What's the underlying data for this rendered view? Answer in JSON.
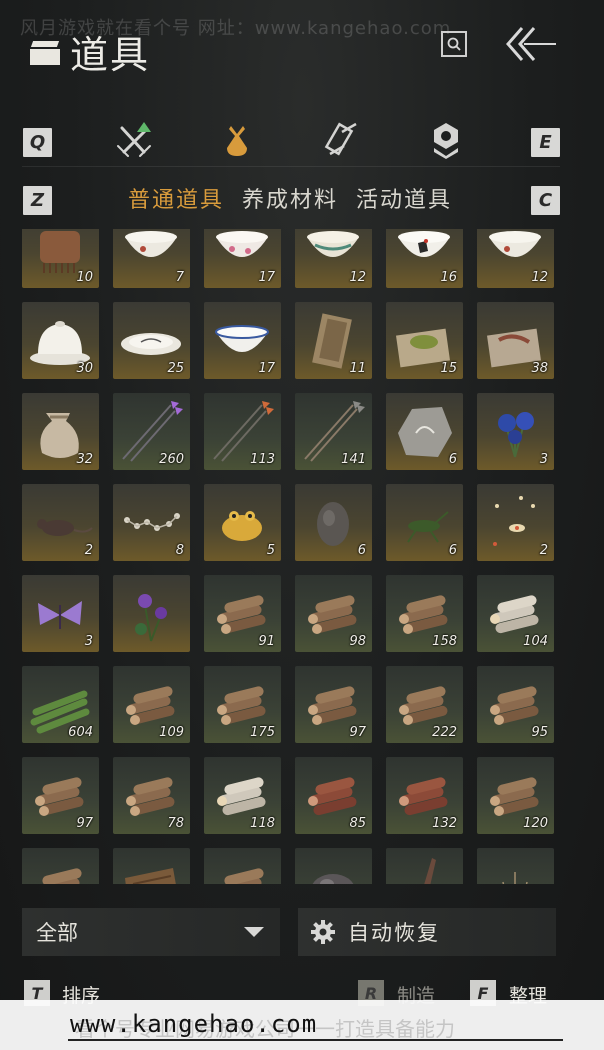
{
  "watermark": {
    "top": "风月游戏就在看个号   网址：www.kangehao.com",
    "banner_url": "www.kangehao.com",
    "banner_faint": "看个号专业网易游戏公司一一打造具备能力"
  },
  "header": {
    "title": "道具",
    "title_icon": "chest-icon",
    "search_icon": "search-icon",
    "back_icon": "double-chevron-left-icon"
  },
  "category_tabs": {
    "prev_key": "Q",
    "next_key": "E",
    "items": [
      {
        "icon": "crossed-swords-icon",
        "active": false,
        "has_badge": true
      },
      {
        "icon": "pouch-icon",
        "active": true,
        "has_badge": false
      },
      {
        "icon": "scroll-icon",
        "active": false,
        "has_badge": false
      },
      {
        "icon": "gem-icon",
        "active": false,
        "has_badge": false
      }
    ]
  },
  "sub_tabs": {
    "prev_key": "Z",
    "next_key": "C",
    "items": [
      {
        "label": "普通道具",
        "active": true
      },
      {
        "label": "养成材料",
        "active": false
      },
      {
        "label": "活动道具",
        "active": false
      }
    ]
  },
  "inventory": {
    "columns": 6,
    "items": [
      {
        "icon": "comb-icon",
        "count": "10",
        "tint": "gold"
      },
      {
        "icon": "porcelain-bowl-icon",
        "count": "7",
        "tint": "gold"
      },
      {
        "icon": "flower-bowl-icon",
        "count": "17",
        "tint": "gold"
      },
      {
        "icon": "painted-bowl-icon",
        "count": "12",
        "tint": "gold"
      },
      {
        "icon": "rooster-bowl-icon",
        "count": "16",
        "tint": "gold"
      },
      {
        "icon": "porcelain-bowl-icon",
        "count": "12",
        "tint": "gold"
      },
      {
        "icon": "covered-bowl-icon",
        "count": "30",
        "tint": "gold"
      },
      {
        "icon": "plate-icon",
        "count": "25",
        "tint": "gold"
      },
      {
        "icon": "blue-rim-bowl-icon",
        "count": "17",
        "tint": "gold"
      },
      {
        "icon": "paper-bundle-icon",
        "count": "11",
        "tint": "gold"
      },
      {
        "icon": "herb-powder-icon",
        "count": "15",
        "tint": "gold"
      },
      {
        "icon": "worm-icon",
        "count": "38",
        "tint": "gold"
      },
      {
        "icon": "sack-icon",
        "count": "32",
        "tint": "gold"
      },
      {
        "icon": "purple-arrows-icon",
        "count": "260",
        "tint": "green"
      },
      {
        "icon": "fire-arrows-icon",
        "count": "113",
        "tint": "green"
      },
      {
        "icon": "arrows-icon",
        "count": "141",
        "tint": "green"
      },
      {
        "icon": "carved-stone-icon",
        "count": "6",
        "tint": "gold"
      },
      {
        "icon": "blue-flower-icon",
        "count": "3",
        "tint": "gold"
      },
      {
        "icon": "rat-icon",
        "count": "2",
        "tint": "gold"
      },
      {
        "icon": "bone-chain-icon",
        "count": "8",
        "tint": "gold"
      },
      {
        "icon": "golden-toad-icon",
        "count": "5",
        "tint": "gold"
      },
      {
        "icon": "cocoon-icon",
        "count": "6",
        "tint": "gold"
      },
      {
        "icon": "cricket-icon",
        "count": "6",
        "tint": "gold"
      },
      {
        "icon": "fireflies-icon",
        "count": "2",
        "tint": "gold"
      },
      {
        "icon": "butterfly-icon",
        "count": "3",
        "tint": "gold"
      },
      {
        "icon": "purple-flower-icon",
        "count": "",
        "tint": "gold"
      },
      {
        "icon": "logs-icon",
        "count": "91",
        "tint": "green"
      },
      {
        "icon": "logs-icon",
        "count": "98",
        "tint": "green"
      },
      {
        "icon": "logs-icon",
        "count": "158",
        "tint": "green"
      },
      {
        "icon": "birch-logs-icon",
        "count": "104",
        "tint": "green"
      },
      {
        "icon": "bamboo-icon",
        "count": "604",
        "tint": "green"
      },
      {
        "icon": "logs-icon",
        "count": "109",
        "tint": "green"
      },
      {
        "icon": "logs-icon",
        "count": "175",
        "tint": "green"
      },
      {
        "icon": "logs-icon",
        "count": "97",
        "tint": "green"
      },
      {
        "icon": "logs-icon",
        "count": "222",
        "tint": "green"
      },
      {
        "icon": "logs-icon",
        "count": "95",
        "tint": "green"
      },
      {
        "icon": "logs-icon",
        "count": "97",
        "tint": "green"
      },
      {
        "icon": "logs-icon",
        "count": "78",
        "tint": "green"
      },
      {
        "icon": "birch-logs-icon",
        "count": "118",
        "tint": "green"
      },
      {
        "icon": "red-logs-icon",
        "count": "85",
        "tint": "green"
      },
      {
        "icon": "red-logs-icon",
        "count": "132",
        "tint": "green"
      },
      {
        "icon": "logs-icon",
        "count": "120",
        "tint": "green"
      },
      {
        "icon": "logs-icon",
        "count": "",
        "tint": "green"
      },
      {
        "icon": "bark-icon",
        "count": "",
        "tint": "green"
      },
      {
        "icon": "logs-icon",
        "count": "",
        "tint": "green"
      },
      {
        "icon": "ore-icon",
        "count": "",
        "tint": "green"
      },
      {
        "icon": "blade-icon",
        "count": "",
        "tint": "green"
      },
      {
        "icon": "shell-icon",
        "count": "",
        "tint": "green"
      }
    ]
  },
  "filter": {
    "label": "全部",
    "icon": "caret-down-icon"
  },
  "auto_restore": {
    "label": "自动恢复",
    "icon": "gear-icon"
  },
  "bottom_actions": [
    {
      "key": "T",
      "label": "排序",
      "enabled": true
    },
    {
      "key": "R",
      "label": "制造",
      "enabled": false
    },
    {
      "key": "F",
      "label": "整理",
      "enabled": true
    }
  ],
  "colors": {
    "accent": "#d89b3c",
    "text": "#e4e2db",
    "bg": "#1d1f1f"
  }
}
